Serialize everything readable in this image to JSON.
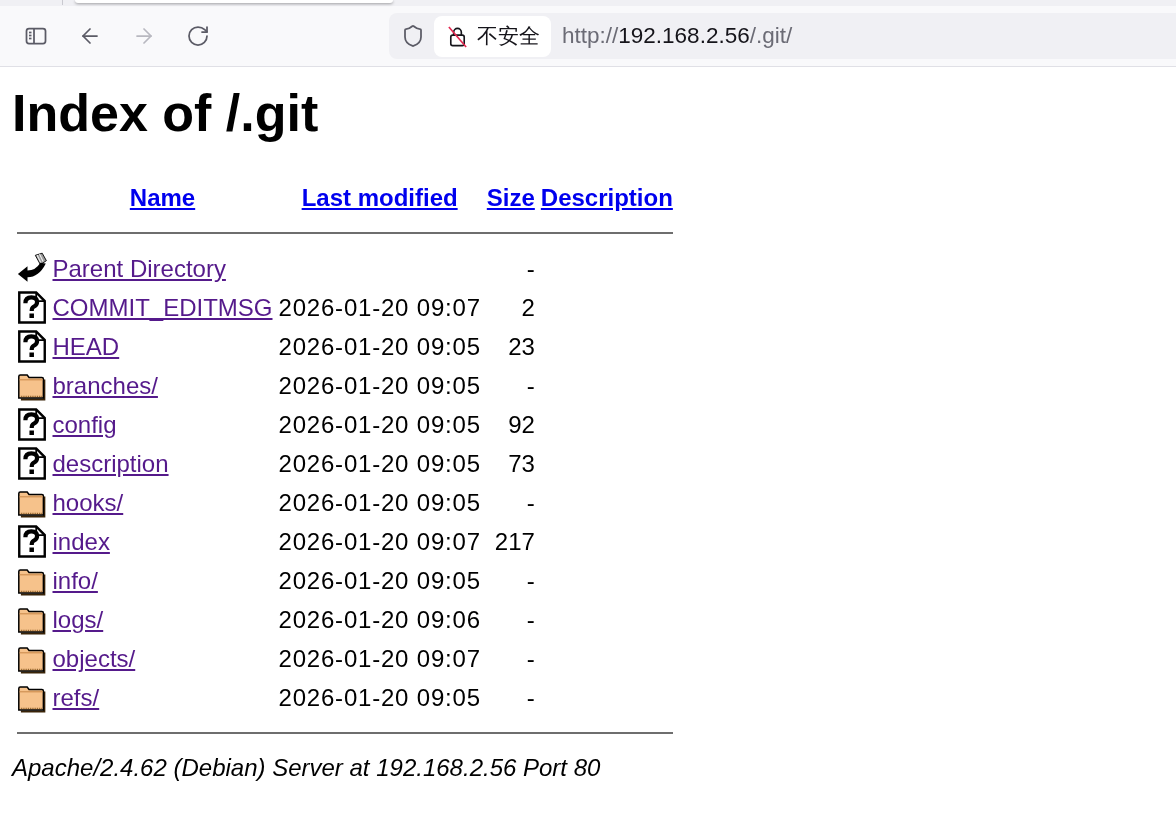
{
  "browser": {
    "tab_strip": {
      "tabs": [
        {
          "selected": true
        }
      ]
    },
    "toolbar": {
      "buttons": [
        {
          "kind": "sidebar",
          "disabled": false
        },
        {
          "kind": "back",
          "disabled": false
        },
        {
          "kind": "forward",
          "disabled": true
        },
        {
          "kind": "reload",
          "disabled": false
        }
      ]
    },
    "address_bar": {
      "security_label": "不安全",
      "url": {
        "scheme": "http://",
        "host": "192.168.2.56",
        "path": "/.git/"
      }
    }
  },
  "page": {
    "heading": "Index of /.git",
    "table": {
      "columns": [
        {
          "label": "Name",
          "visited": false
        },
        {
          "label": "Last modified",
          "visited": false
        },
        {
          "label": "Size",
          "visited": false
        },
        {
          "label": "Description",
          "visited": false
        }
      ],
      "rows": [
        {
          "kind": "parent",
          "name": "Parent Directory",
          "visited": true,
          "size": "-"
        },
        {
          "kind": "file",
          "name": "COMMIT_EDITMSG",
          "visited": true,
          "last_modified": "2026-01-20 09:07",
          "size": "2"
        },
        {
          "kind": "file",
          "name": "HEAD",
          "visited": true,
          "last_modified": "2026-01-20 09:05",
          "size": "23"
        },
        {
          "kind": "folder",
          "name": "branches/",
          "visited": true,
          "last_modified": "2026-01-20 09:05",
          "size": "-"
        },
        {
          "kind": "file",
          "name": "config",
          "visited": true,
          "last_modified": "2026-01-20 09:05",
          "size": "92"
        },
        {
          "kind": "file",
          "name": "description",
          "visited": true,
          "last_modified": "2026-01-20 09:05",
          "size": "73"
        },
        {
          "kind": "folder",
          "name": "hooks/",
          "visited": true,
          "last_modified": "2026-01-20 09:05",
          "size": "-"
        },
        {
          "kind": "file",
          "name": "index",
          "visited": true,
          "last_modified": "2026-01-20 09:07",
          "size": "217"
        },
        {
          "kind": "folder",
          "name": "info/",
          "visited": true,
          "last_modified": "2026-01-20 09:05",
          "size": "-"
        },
        {
          "kind": "folder",
          "name": "logs/",
          "visited": true,
          "last_modified": "2026-01-20 09:06",
          "size": "-"
        },
        {
          "kind": "folder",
          "name": "objects/",
          "visited": true,
          "last_modified": "2026-01-20 09:07",
          "size": "-"
        },
        {
          "kind": "folder",
          "name": "refs/",
          "visited": true,
          "last_modified": "2026-01-20 09:05",
          "size": "-"
        }
      ]
    },
    "footer": "Apache/2.4.62 (Debian) Server at 192.168.2.56 Port 80"
  }
}
